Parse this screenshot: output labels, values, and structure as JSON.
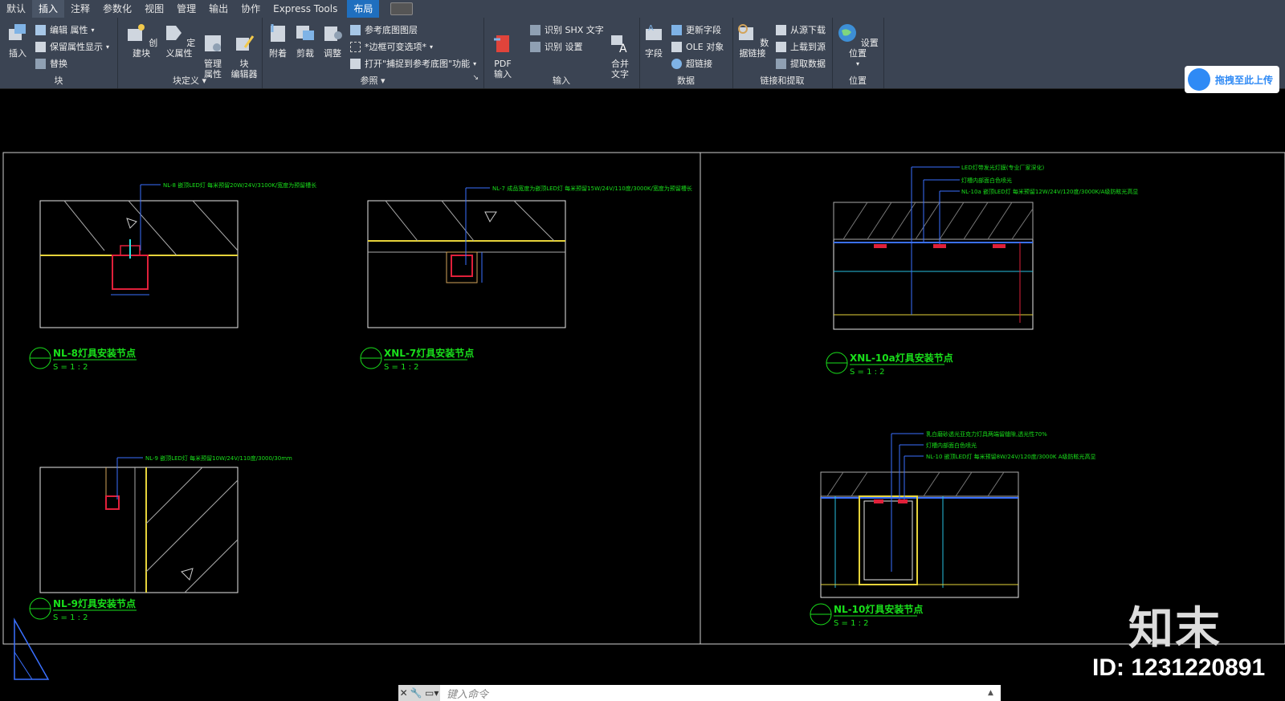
{
  "tabs": [
    "默认",
    "插入",
    "注释",
    "参数化",
    "视图",
    "管理",
    "输出",
    "协作",
    "Express Tools",
    "布局"
  ],
  "active_tab": "插入",
  "ribbon": {
    "block": {
      "title": "块",
      "insert": "插入",
      "edit_attr": "编辑 属性",
      "keep_attr": "保留属性显示",
      "replace": "替换"
    },
    "block_def": {
      "title": "块定义",
      "create": "创建块",
      "define_attr": "定义属性",
      "manage_attr": "管理\n属性",
      "block_editor": "块\n编辑器"
    },
    "reference": {
      "title": "参照",
      "attach": "附着",
      "clip": "剪裁",
      "adjust": "调整",
      "underlay_layers": "参考底图图层",
      "frame": "*边框可变选项*",
      "snap": "打开\"捕捉到参考底图\"功能"
    },
    "import": {
      "title": "输入",
      "pdf": "PDF\n输入",
      "shx": "识别 SHX 文字",
      "settings": "识别 设置",
      "merge": "合并\n文字"
    },
    "data": {
      "title": "数据",
      "field": "字段",
      "update_field": "更新字段",
      "ole": "OLE 对象",
      "hyperlink": "超链接"
    },
    "linking": {
      "title": "链接和提取",
      "data_link": "数据链接",
      "download": "从源下载",
      "upload": "上载到源",
      "extract": "提取数据"
    },
    "location": {
      "title": "位置",
      "set": "设置位置"
    }
  },
  "upload_button": "拖拽至此上传",
  "drawings": [
    {
      "label": "NL-8灯具安装节点",
      "scale": "S = 1 : 2",
      "note": "NL-8 嵌顶LED灯 每米预留20W/24V/3100K/宽度为预留槽长"
    },
    {
      "label": "XNL-7灯具安装节点",
      "scale": "S = 1 : 2",
      "note": "NL-7 成品宽度为嵌顶LED灯 每米预留15W/24V/110度/3000K/宽度为预留槽长"
    },
    {
      "label": "XNL-10a灯具安装节点",
      "scale": "S = 1 : 2",
      "note1": "LED灯带发光灯膜(专业厂家深化)",
      "note2": "灯槽内部面白色喷光",
      "note3": "NL-10a 嵌顶LED灯 每米预留12W/24V/120度/3000K/A级防眩光高显"
    },
    {
      "label": "NL-9灯具安装节点",
      "scale": "S = 1 : 2",
      "note": "NL-9 嵌顶LED灯 每米预留10W/24V/110度/3000/30mm"
    },
    {
      "label": "NL-10灯具安装节点",
      "scale": "S = 1 : 2",
      "note1": "乳白磨砂透光亚克力灯具两端留缝隙,透光性70%",
      "note2": "灯槽内部面白色喷光",
      "note3": "NL-10 嵌顶LED灯 每米预留8W/24V/120度/3000K A级防眩光高显"
    }
  ],
  "command_placeholder": "键入命令",
  "watermark": {
    "logo": "知末",
    "id": "ID: 1231220891"
  }
}
